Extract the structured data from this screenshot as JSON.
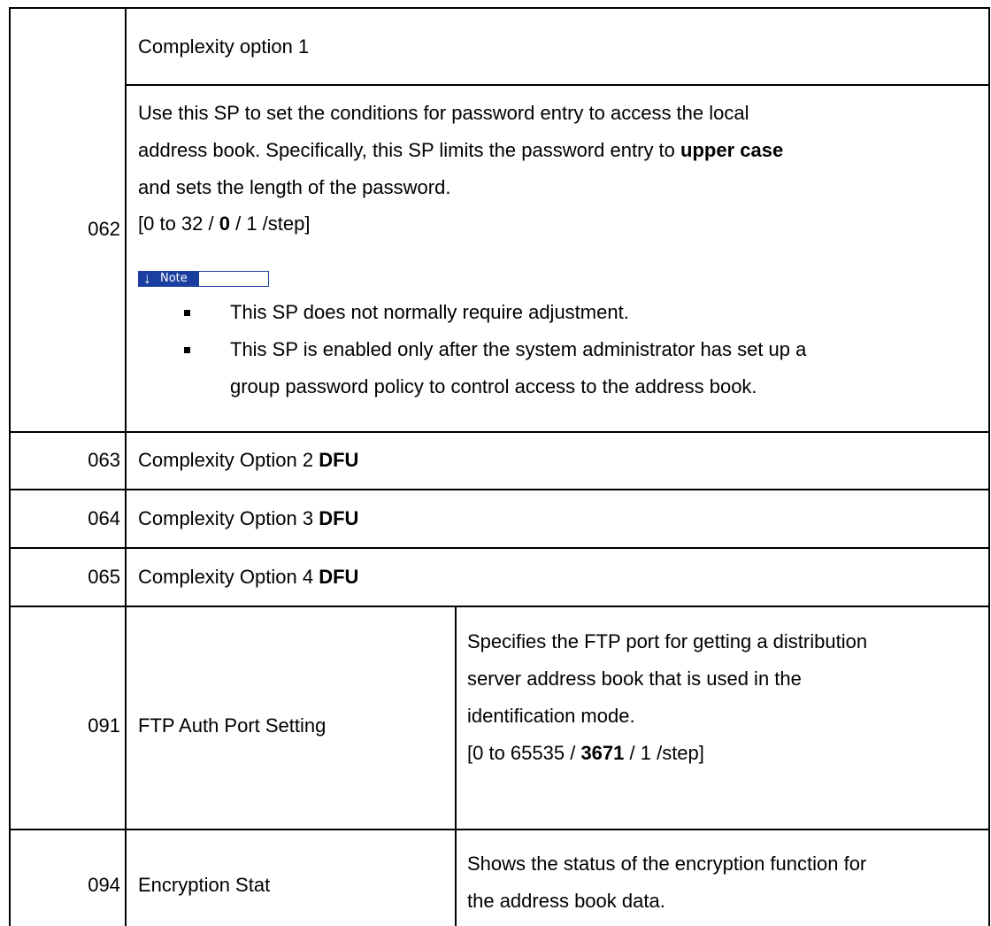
{
  "rows": {
    "r062": {
      "num": "062",
      "title": "Complexity option 1",
      "desc_line1": "Use this SP to set the conditions for password entry to access the local",
      "desc_line2_pre": "address book. Specifically, this SP limits the password entry to ",
      "desc_line2_bold": "upper case",
      "desc_line3": "and sets the length of the password.",
      "range_pre": "[0 to 32 / ",
      "range_bold": "0",
      "range_post": " / 1 /step]",
      "note_label": "Note",
      "note_icon": "down-arrow-icon",
      "bullets": [
        "This SP does not normally require adjustment.",
        "This SP is enabled only after the system administrator has set up a",
        "group password policy to control access to the address book."
      ]
    },
    "r063": {
      "num": "063",
      "title": "Complexity Option 2 ",
      "flag": "DFU"
    },
    "r064": {
      "num": "064",
      "title": "Complexity Option 3 ",
      "flag": "DFU"
    },
    "r065": {
      "num": "065",
      "title": "Complexity Option 4 ",
      "flag": "DFU"
    },
    "r091": {
      "num": "091",
      "name": "FTP Auth Port Setting",
      "desc_line1": "Specifies the FTP port for getting a distribution",
      "desc_line2": "server address book that is used in the",
      "desc_line3": "identification mode.",
      "range_pre": "[0 to 65535 / ",
      "range_bold": "3671",
      "range_post": " / 1 /step]"
    },
    "r094": {
      "num": "094",
      "name": "Encryption Stat",
      "desc_line1": "Shows the status of the encryption function for",
      "desc_line2": "the address book data."
    }
  }
}
